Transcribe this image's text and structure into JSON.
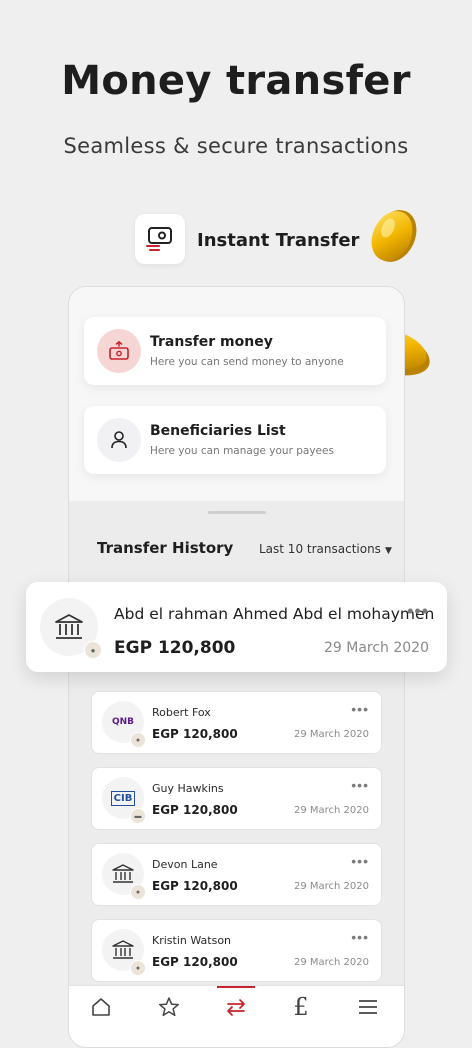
{
  "headline": "Money transfer",
  "subline": "Seamless  & secure transactions",
  "feature_label": "Instant Transfer",
  "colors": {
    "accent": "#c8232c",
    "background": "#efefef",
    "coin": "#f2b600"
  },
  "actions": [
    {
      "title": "Transfer money",
      "subtitle": "Here you can send money to anyone",
      "icon": "money-transfer-icon"
    },
    {
      "title": "Beneficiaries List",
      "subtitle": "Here you can manage your payees",
      "icon": "user-icon"
    }
  ],
  "history": {
    "title": "Transfer History",
    "filter": "Last 10 transactions",
    "featured": {
      "name": "Abd el rahman Ahmed Abd el mohaymen",
      "amount": "EGP 120,800",
      "date": "29 March 2020",
      "icon": "bank-icon"
    },
    "items": [
      {
        "name": "Robert Fox",
        "amount": "EGP 120,800",
        "date": "29 March 2020",
        "logo_text": "QNB",
        "icon": "qnb-logo"
      },
      {
        "name": "Guy Hawkins",
        "amount": "EGP 120,800",
        "date": "29 March 2020",
        "logo_text": "CIB",
        "icon": "cib-logo"
      },
      {
        "name": "Devon Lane",
        "amount": "EGP 120,800",
        "date": "29 March 2020",
        "icon": "bank-icon"
      },
      {
        "name": "Kristin Watson",
        "amount": "EGP 120,800",
        "date": "29 March 2020",
        "icon": "bank-icon"
      }
    ]
  },
  "nav": [
    {
      "name": "home",
      "icon": "home-icon",
      "active": false
    },
    {
      "name": "favorites",
      "icon": "star-icon",
      "active": false
    },
    {
      "name": "transfer",
      "icon": "transfer-icon",
      "active": true
    },
    {
      "name": "payments",
      "icon": "pound-icon",
      "active": false
    },
    {
      "name": "menu",
      "icon": "menu-icon",
      "active": false
    }
  ]
}
